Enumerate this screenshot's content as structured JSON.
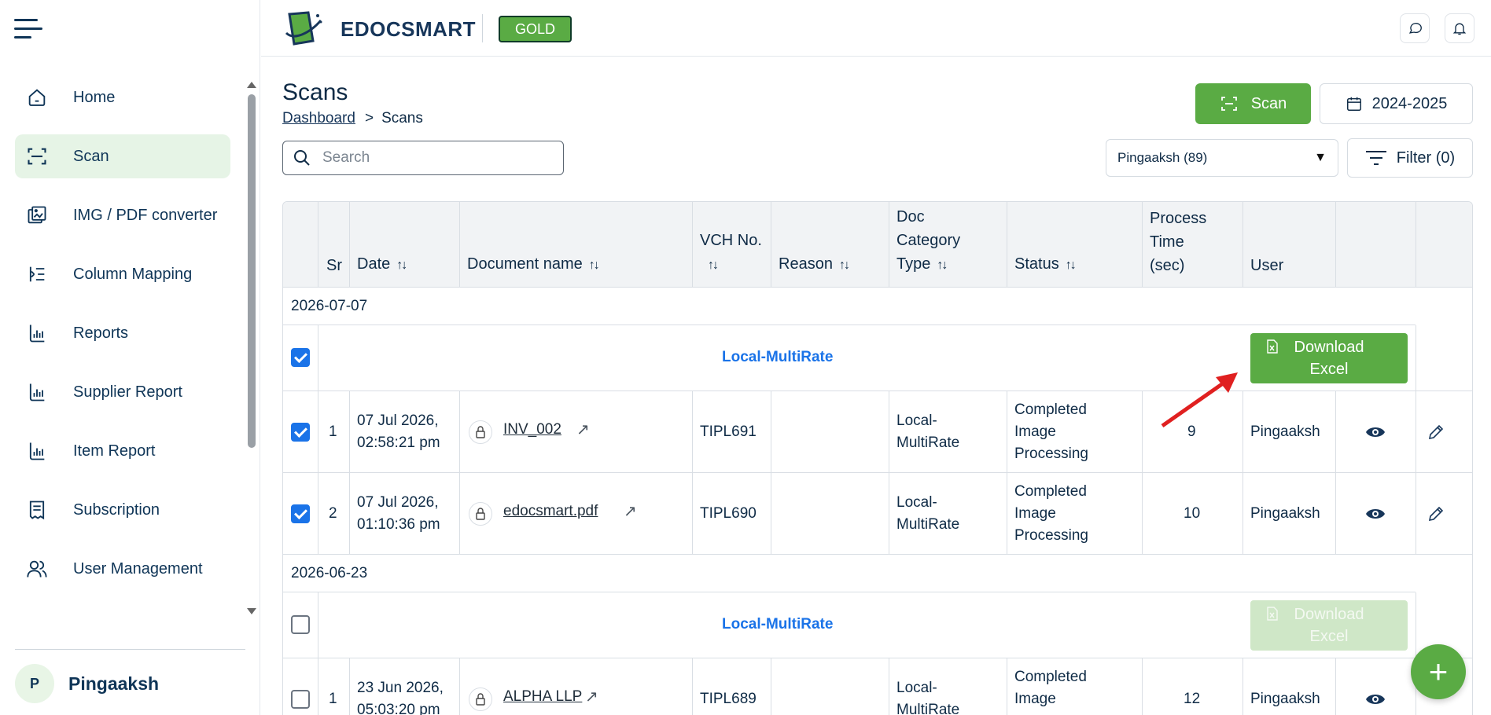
{
  "sidebar": {
    "items": [
      {
        "label": "Home",
        "icon": "home-icon"
      },
      {
        "label": "Scan",
        "icon": "scan-icon",
        "active": true
      },
      {
        "label": "IMG / PDF converter",
        "icon": "converter-icon"
      },
      {
        "label": "Column Mapping",
        "icon": "column-mapping-icon"
      },
      {
        "label": "Reports",
        "icon": "chart-icon"
      },
      {
        "label": "Supplier Report",
        "icon": "chart-icon"
      },
      {
        "label": "Item Report",
        "icon": "chart-icon"
      },
      {
        "label": "Subscription",
        "icon": "receipt-icon"
      },
      {
        "label": "User Management",
        "icon": "users-icon"
      }
    ],
    "profile": {
      "initial": "P",
      "name": "Pingaaksh"
    }
  },
  "topbar": {
    "brand": "EDOCSMART",
    "plan_badge": "GOLD"
  },
  "page": {
    "title": "Scans",
    "breadcrumb": {
      "parent": "Dashboard",
      "separator": ">",
      "current": "Scans"
    },
    "scan_button": "Scan",
    "year_button": "2024-2025",
    "search_placeholder": "Search",
    "user_select": "Pingaaksh (89)",
    "filter_button": "Filter (0)"
  },
  "table": {
    "headers": {
      "sr": "Sr",
      "date": "Date",
      "document_name": "Document name",
      "vch_line1": "VCH No.",
      "reason": "Reason",
      "doc_cat_line1": "Doc",
      "doc_cat_line2": "Category",
      "doc_cat_line3": "Type",
      "status": "Status",
      "process_line1": "Process",
      "process_line2": "Time",
      "process_line3": "(sec)",
      "user": "User"
    },
    "groups": [
      {
        "date": "2026-07-07",
        "category": "Local-MultiRate",
        "download_line1": "Download",
        "download_line2": "Excel",
        "checked": true,
        "rows": [
          {
            "sr": "1",
            "date_line1": "07 Jul 2026,",
            "date_line2": "02:58:21 pm",
            "document": "INV_002",
            "vch": "TIPL691",
            "reason": "",
            "category_line1": "Local-",
            "category_line2": "MultiRate",
            "status_line1": "Completed",
            "status_line2": "Image",
            "status_line3": "Processing",
            "process_time": "9",
            "user": "Pingaaksh",
            "checked": true
          },
          {
            "sr": "2",
            "date_line1": "07 Jul 2026,",
            "date_line2": "01:10:36 pm",
            "document": "edocsmart.pdf",
            "vch": "TIPL690",
            "reason": "",
            "category_line1": "Local-",
            "category_line2": "MultiRate",
            "status_line1": "Completed",
            "status_line2": "Image",
            "status_line3": "Processing",
            "process_time": "10",
            "user": "Pingaaksh",
            "checked": true
          }
        ]
      },
      {
        "date": "2026-06-23",
        "category": "Local-MultiRate",
        "download_line1": "Download",
        "download_line2": "Excel",
        "checked": false,
        "rows": [
          {
            "sr": "1",
            "date_line1": "23 Jun 2026,",
            "date_line2": "05:03:20 pm",
            "document": "ALPHA LLP",
            "vch": "TIPL689",
            "reason": "",
            "category_line1": "Local-",
            "category_line2": "MultiRate",
            "status_line1": "Completed",
            "status_line2": "Image",
            "process_time": "12",
            "user": "Pingaaksh",
            "checked": false
          }
        ]
      }
    ]
  },
  "colors": {
    "accent": "#5aab44",
    "link_blue": "#1a73e8",
    "navy": "#0f3557"
  }
}
